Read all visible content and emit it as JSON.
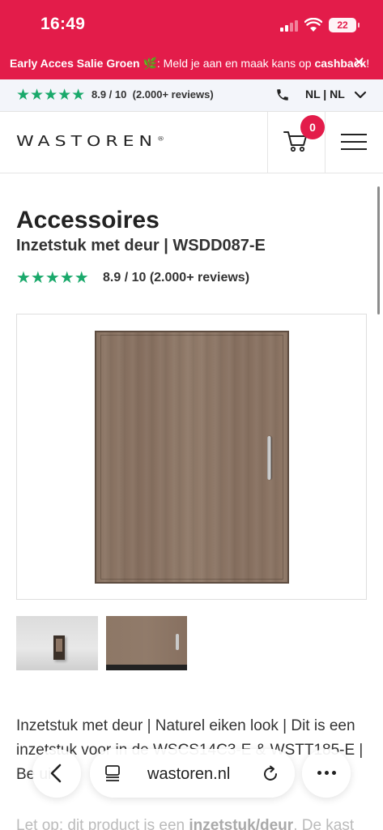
{
  "status_bar": {
    "time": "16:49",
    "battery": "22"
  },
  "announcement": {
    "bold_text": "Early Acces Salie Groen",
    "emoji": "🌿",
    "text": ": Meld je aan en maak kans op ",
    "bold_end": "cashback",
    "end": "!",
    "close_label": "✕"
  },
  "review_bar": {
    "stars": "★★★★★",
    "score": "8.9 / 10",
    "count": "(2.000+ reviews)",
    "language": "NL | NL"
  },
  "header": {
    "logo": "WASTOREN",
    "logo_mark": "®",
    "cart_count": "0"
  },
  "product": {
    "category": "Accessoires",
    "name": "Inzetstuk met deur | WSDD087-E",
    "rating_stars": "★★★★★",
    "rating_text": "8.9 / 10 (2.000+ reviews)",
    "description": "Inzetstuk met deur | Naturel eiken look | Dit is een inzetstuk voor in de WSCS14C3-E & WSTT185-E | Be  ui",
    "description_2_prefix": "Let op: dit product is een ",
    "description_2_bold": "inzetstuk/deur",
    "description_2_suffix": ". De kast"
  },
  "browser": {
    "url": "wastoren.nl"
  },
  "colors": {
    "brand": "#e31c4a",
    "stars": "#1aa96b"
  }
}
